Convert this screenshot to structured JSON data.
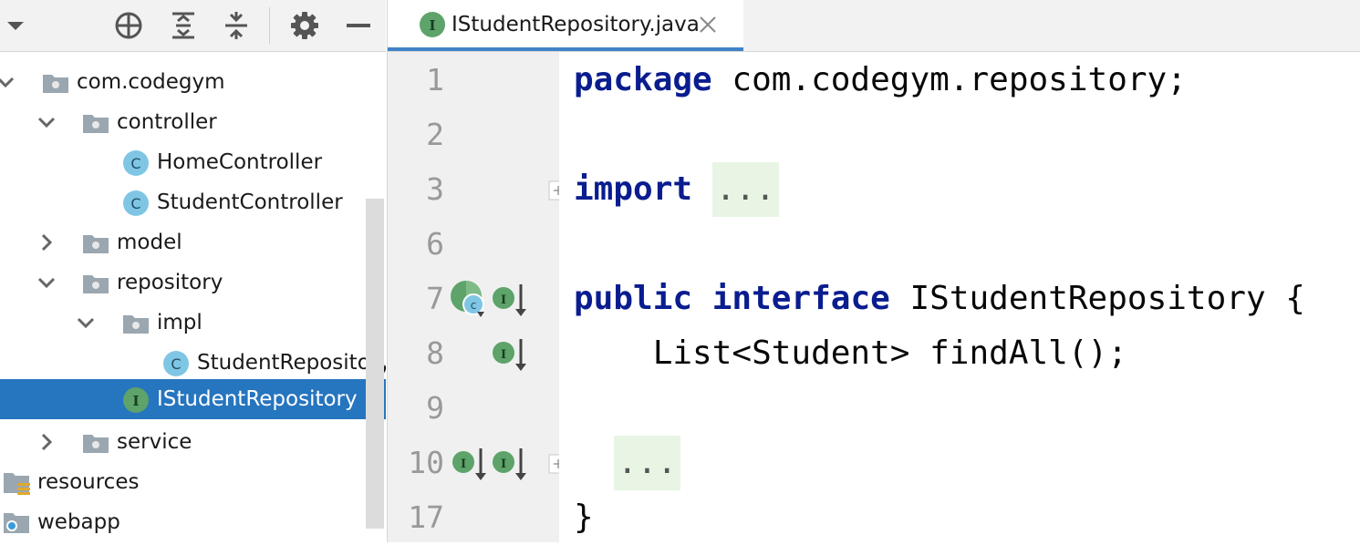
{
  "project_panel": {
    "toolbar": {
      "select_opened_file_icon": "crosshair-icon",
      "expand_all_icon": "expand-all-icon",
      "collapse_all_icon": "collapse-all-icon",
      "options_icon": "gear-icon",
      "hide_icon": "minimize-icon"
    },
    "tree": [
      {
        "label": "com.codegym",
        "type": "package",
        "expanded": true
      },
      {
        "label": "controller",
        "type": "package",
        "expanded": true
      },
      {
        "label": "HomeController",
        "type": "class"
      },
      {
        "label": "StudentController",
        "type": "class"
      },
      {
        "label": "model",
        "type": "package",
        "expanded": false
      },
      {
        "label": "repository",
        "type": "package",
        "expanded": true
      },
      {
        "label": "impl",
        "type": "package",
        "expanded": true
      },
      {
        "label": "StudentRepository",
        "type": "class"
      },
      {
        "label": "IStudentRepository",
        "type": "interface",
        "selected": true
      },
      {
        "label": "service",
        "type": "package",
        "expanded": false
      },
      {
        "label": "resources",
        "type": "resources-folder"
      },
      {
        "label": "webapp",
        "type": "web-folder"
      }
    ]
  },
  "editor": {
    "tab": {
      "title": "IStudentRepository.java",
      "icon": "interface-icon"
    },
    "line_numbers": [
      "1",
      "2",
      "3",
      "6",
      "7",
      "8",
      "9",
      "10",
      "17"
    ],
    "code": {
      "line1_kw": "package",
      "line1_rest": " com.codegym.repository;",
      "line3_kw": "import",
      "line3_fold": "...",
      "line7_kw1": "public",
      "line7_kw2": "interface",
      "line7_rest": " IStudentRepository {",
      "line8": "    List<Student> findAll();",
      "line10_fold": "...",
      "line17": "}"
    }
  },
  "colors": {
    "selection": "#2675bf",
    "keyword": "#0a1d8f",
    "class_icon": "#7fc6e4",
    "interface_icon": "#5da36a",
    "tab_underline": "#4083c9"
  }
}
